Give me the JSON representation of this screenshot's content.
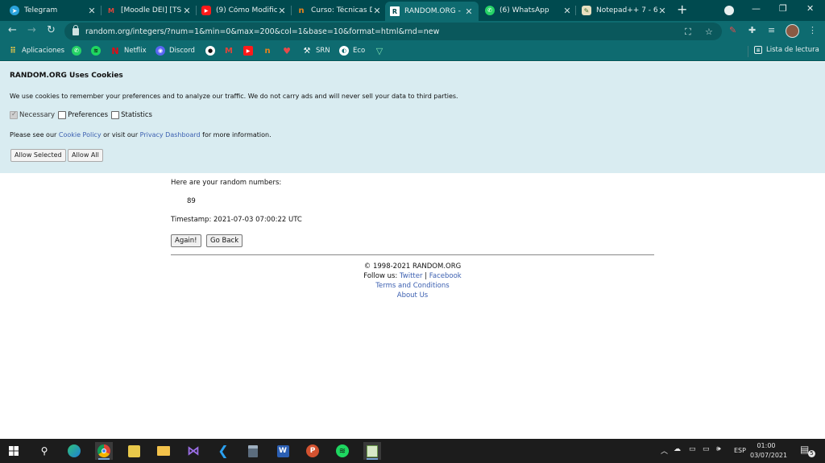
{
  "browser": {
    "tabs": [
      {
        "title": "Telegram",
        "icon": "telegram-icon",
        "color": "#2aa3dd",
        "glyph": "➤"
      },
      {
        "title": "[Moodle DEI] [TS",
        "icon": "gmail-icon",
        "color": "#e0453a",
        "glyph": "M"
      },
      {
        "title": "(9) Cómo Modific",
        "icon": "youtube-icon",
        "color": "#ff1a1a",
        "glyph": "▶"
      },
      {
        "title": "Curso: Técnicas D",
        "icon": "course-icon",
        "color": "#e9841c",
        "glyph": "n"
      },
      {
        "title": "RANDOM.ORG - ",
        "icon": "random-org-icon",
        "color": "#ffffff",
        "glyph": "R"
      },
      {
        "title": "(6) WhatsApp",
        "icon": "whatsapp-icon",
        "color": "#25d366",
        "glyph": "✆"
      },
      {
        "title": "Notepad++ 7 - 6",
        "icon": "notepad-icon",
        "color": "#e8e0c0",
        "glyph": "✎"
      }
    ],
    "url": "random.org/integers/?num=1&min=0&max=200&col=1&base=10&format=html&rnd=new",
    "bookmarks": [
      {
        "label": "Aplicaciones",
        "icon": "apps-grid-icon"
      },
      {
        "label": "",
        "icon": "whatsapp-icon"
      },
      {
        "label": "",
        "icon": "spotify-icon"
      },
      {
        "label": "Netflix",
        "icon": "netflix-icon"
      },
      {
        "label": "Discord",
        "icon": "discord-icon"
      },
      {
        "label": "",
        "icon": "github-icon"
      },
      {
        "label": "",
        "icon": "gmail-icon"
      },
      {
        "label": "",
        "icon": "youtube-icon"
      },
      {
        "label": "",
        "icon": "course-icon"
      },
      {
        "label": "",
        "icon": "heart-icon"
      },
      {
        "label": "SRN",
        "icon": "srn-icon"
      },
      {
        "label": "Eco",
        "icon": "eco-icon"
      },
      {
        "label": "",
        "icon": "vuetify-icon"
      }
    ],
    "reading_list": "Lista de lectura"
  },
  "cookie_banner": {
    "title": "RANDOM.ORG Uses Cookies",
    "text": "We use cookies to remember your preferences and to analyze our traffic. We do not carry ads and will never sell your data to third parties.",
    "options": [
      {
        "label": "Necessary",
        "checked": true,
        "disabled": true
      },
      {
        "label": "Preferences",
        "checked": false,
        "disabled": false
      },
      {
        "label": "Statistics",
        "checked": false,
        "disabled": false
      }
    ],
    "more_prefix": "Please see our ",
    "cookie_policy": "Cookie Policy",
    "more_middle": " or visit our ",
    "privacy_dashboard": "Privacy Dashboard",
    "more_suffix": " for more information.",
    "allow_selected": "Allow Selected",
    "allow_all": "Allow All"
  },
  "main": {
    "intro": "Here are your random numbers:",
    "number": "89",
    "timestamp": "Timestamp: 2021-07-03 07:00:22 UTC",
    "again_label": "Again!",
    "go_back_label": "Go Back"
  },
  "footer": {
    "copyright": "© 1998-2021 RANDOM.ORG",
    "follow_prefix": "Follow us: ",
    "twitter": "Twitter",
    "separator": " | ",
    "facebook": "Facebook",
    "terms": "Terms and Conditions",
    "about": "About Us"
  },
  "taskbar": {
    "language": "ESP",
    "time": "01:00",
    "date": "03/07/2021",
    "notification_count": "5"
  },
  "colors": {
    "tabstrip": "#004a4f",
    "toolbar": "#0e6b70",
    "cookie_bg": "#d9ecf1",
    "link": "#3b5fb0",
    "taskbar": "#1c1c1c"
  }
}
